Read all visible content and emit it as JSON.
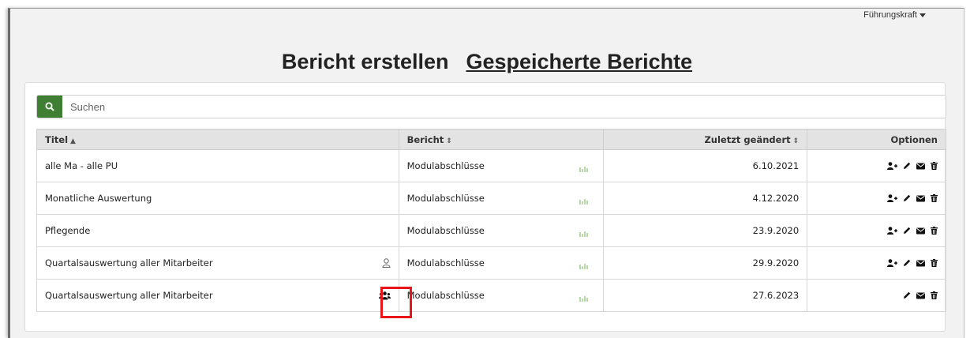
{
  "header": {
    "user_menu": "Führungskraft",
    "title_create": "Bericht erstellen",
    "title_saved": "Gespeicherte Berichte"
  },
  "search": {
    "placeholder": "Suchen"
  },
  "table": {
    "columns": [
      {
        "label": "Titel",
        "sort": "▲"
      },
      {
        "label": "Bericht",
        "sort": "⇕"
      },
      {
        "label": "Zuletzt geändert",
        "sort": "⇕"
      },
      {
        "label": "Optionen"
      }
    ],
    "rows": [
      {
        "title": "alle Ma - alle PU",
        "report": "Modulabschlüsse",
        "date": "6.10.2021",
        "share_icon": null,
        "options": [
          "add-user-icon",
          "pencil-icon",
          "envelope-icon",
          "trash-icon"
        ]
      },
      {
        "title": "Monatliche Auswertung",
        "report": "Modulabschlüsse",
        "date": "4.12.2020",
        "share_icon": null,
        "options": [
          "add-user-icon",
          "pencil-icon",
          "envelope-icon",
          "trash-icon"
        ]
      },
      {
        "title": "Pflegende",
        "report": "Modulabschlüsse",
        "date": "23.9.2020",
        "share_icon": null,
        "options": [
          "add-user-icon",
          "pencil-icon",
          "envelope-icon",
          "trash-icon"
        ]
      },
      {
        "title": "Quartalsauswertung aller Mitarbeiter",
        "report": "Modulabschlüsse",
        "date": "29.9.2020",
        "share_icon": "user-outline-icon",
        "options": [
          "add-user-icon",
          "pencil-icon",
          "envelope-icon",
          "trash-icon"
        ]
      },
      {
        "title": "Quartalsauswertung aller Mitarbeiter",
        "report": "Modulabschlüsse",
        "date": "27.6.2023",
        "share_icon": "users-group-icon",
        "options": [
          "pencil-icon",
          "envelope-icon",
          "trash-icon"
        ]
      }
    ]
  },
  "colors": {
    "search_button": "#3e7f34",
    "header_bg": "#e3e3e3",
    "highlight": "#e8151b",
    "chart_icon": "#b7d9a8"
  }
}
